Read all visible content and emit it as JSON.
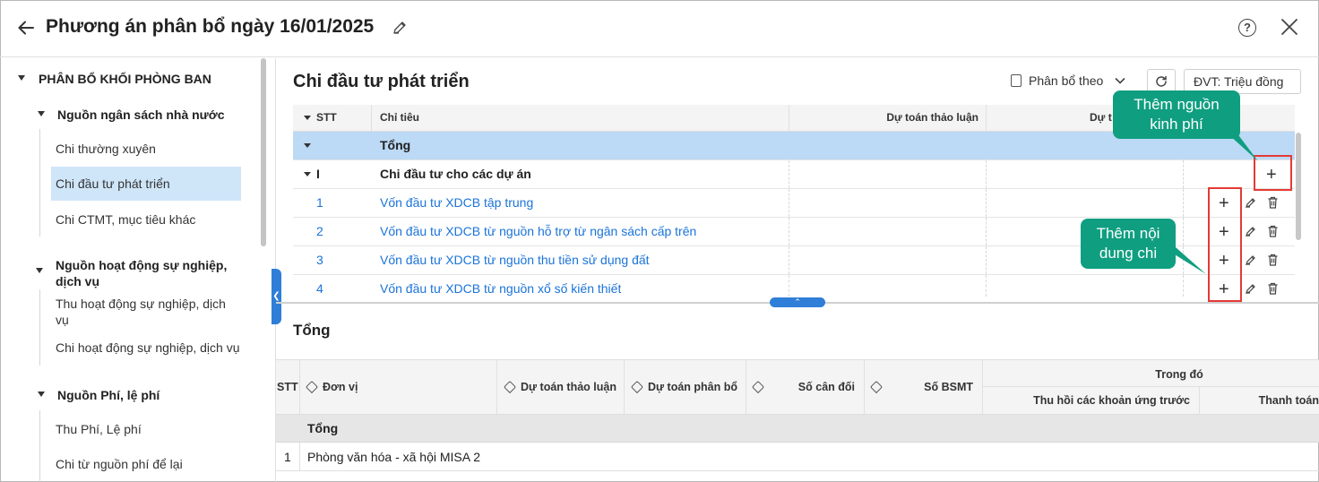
{
  "header": {
    "title": "Phương án phân bổ ngày 16/01/2025"
  },
  "sidebar": {
    "section_title": "PHÂN BỔ KHỐI PHÒNG BAN",
    "group1": {
      "label": "Nguồn ngân sách nhà nước",
      "items": [
        "Chi thường xuyên",
        "Chi đầu tư phát triển",
        "Chi CTMT, mục tiêu khác"
      ],
      "selected": "Chi đầu tư phát triển"
    },
    "group2": {
      "label_line1": "Nguồn hoạt động sự nghiệp,",
      "label_line2": "dịch vụ",
      "items": [
        [
          "Thu hoạt động sự nghiệp, dịch",
          "vụ"
        ],
        "Chi hoạt động sự nghiệp, dịch vụ"
      ]
    },
    "group3": {
      "label": "Nguồn Phí, lệ phí",
      "items": [
        "Thu Phí, Lệ phí",
        "Chi từ nguồn phí để lại"
      ]
    }
  },
  "main": {
    "title": "Chi đầu tư phát triển",
    "allocate_by": "Phân bổ theo",
    "unit": "ĐVT: Triệu đồng",
    "columns": {
      "stt": "STT",
      "indicator": "Chỉ tiêu",
      "discussion": "Dự toán thảo luận",
      "allocate_partial": "Dự t"
    },
    "total_label": "Tổng",
    "group_row": {
      "stt": "I",
      "label": "Chi đầu tư cho các dự án"
    },
    "rows": [
      {
        "stt": "1",
        "label": "Vốn đầu tư XDCB tập trung"
      },
      {
        "stt": "2",
        "label": "Vốn đầu tư XDCB từ nguồn hỗ trợ từ ngân sách cấp trên"
      },
      {
        "stt": "3",
        "label": "Vốn đầu tư XDCB từ nguồn thu tiền sử dụng đất"
      },
      {
        "stt": "4",
        "label": "Vốn đầu tư XDCB từ nguồn xổ số kiến thiết"
      }
    ],
    "callouts": {
      "add_source": [
        "Thêm nguồn",
        "kinh phí"
      ],
      "add_content": [
        "Thêm nội",
        "dung chi"
      ]
    }
  },
  "bottom": {
    "title": "Tổng",
    "columns": {
      "stt": "STT",
      "unit": "Đơn vị",
      "discussion": "Dự toán thảo luận",
      "allocation": "Dự toán phân bổ",
      "balance": "Số cân đối",
      "bsmt": "Số BSMT",
      "of_which": "Trong đó",
      "recovery": "Thu hồi các khoản ứng trước",
      "payment": "Thanh toán"
    },
    "total_label": "Tổng",
    "rows": [
      {
        "stt": "1",
        "unit": "Phòng văn hóa - xã hội MISA 2"
      }
    ]
  },
  "colors": {
    "accent": "#2f7ed8",
    "selected": "#cfe6f9",
    "total_row": "#bcd9f5",
    "callout": "#0f9e80",
    "highlight": "#e53935"
  }
}
